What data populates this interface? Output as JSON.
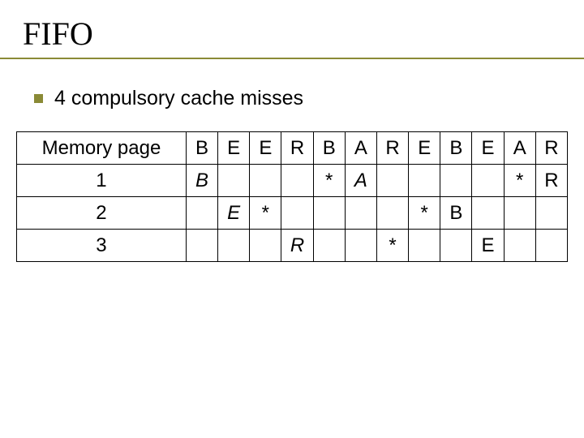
{
  "title": "FIFO",
  "bullet": "4 compulsory cache misses",
  "table": {
    "header_label": "Memory page",
    "ref": [
      "B",
      "E",
      "E",
      "R",
      "B",
      "A",
      "R",
      "E",
      "B",
      "E",
      "A",
      "R"
    ],
    "rows": [
      {
        "label": "1",
        "cells": [
          {
            "t": "B",
            "i": true
          },
          {
            "t": ""
          },
          {
            "t": ""
          },
          {
            "t": ""
          },
          {
            "t": "*"
          },
          {
            "t": "A",
            "i": true
          },
          {
            "t": ""
          },
          {
            "t": ""
          },
          {
            "t": ""
          },
          {
            "t": ""
          },
          {
            "t": "*"
          },
          {
            "t": "R"
          }
        ]
      },
      {
        "label": "2",
        "cells": [
          {
            "t": ""
          },
          {
            "t": "E",
            "i": true
          },
          {
            "t": "*"
          },
          {
            "t": ""
          },
          {
            "t": ""
          },
          {
            "t": ""
          },
          {
            "t": ""
          },
          {
            "t": "*"
          },
          {
            "t": "B"
          },
          {
            "t": ""
          },
          {
            "t": ""
          },
          {
            "t": ""
          }
        ]
      },
      {
        "label": "3",
        "cells": [
          {
            "t": ""
          },
          {
            "t": ""
          },
          {
            "t": ""
          },
          {
            "t": "R",
            "i": true
          },
          {
            "t": ""
          },
          {
            "t": ""
          },
          {
            "t": "*"
          },
          {
            "t": ""
          },
          {
            "t": ""
          },
          {
            "t": "E"
          },
          {
            "t": ""
          },
          {
            "t": ""
          }
        ]
      }
    ]
  }
}
